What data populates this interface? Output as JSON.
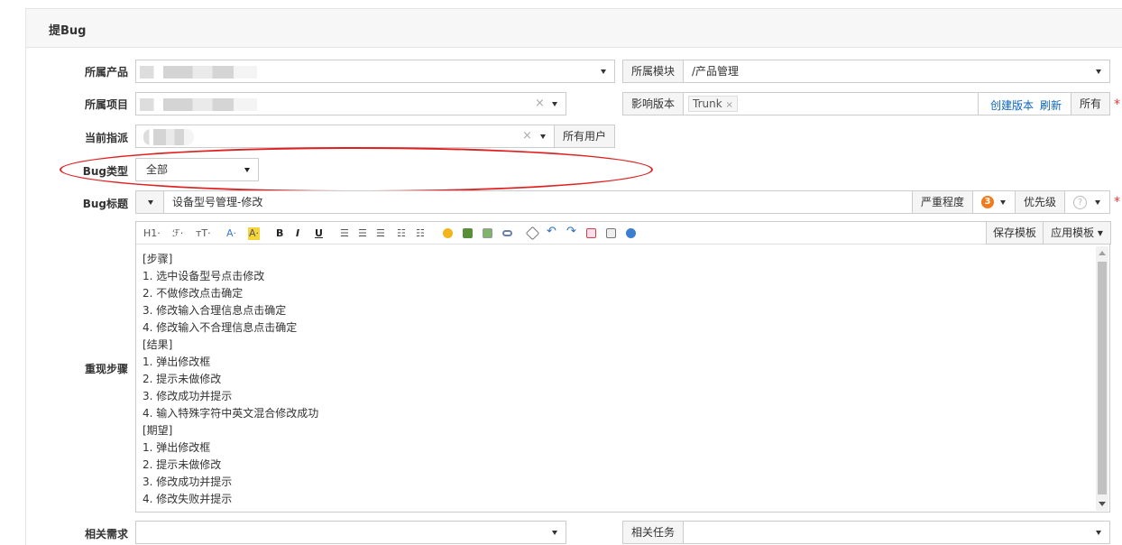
{
  "header": {
    "title": "提Bug"
  },
  "form": {
    "product": {
      "label": "所属产品"
    },
    "module": {
      "addon": "所属模块",
      "value": "/产品管理"
    },
    "project": {
      "label": "所属项目"
    },
    "build": {
      "addon": "影响版本",
      "tag": "Trunk",
      "create_link": "创建版本",
      "refresh_link": "刷新",
      "all_button": "所有"
    },
    "assign": {
      "label": "当前指派",
      "all_users": "所有用户"
    },
    "bug_type": {
      "label": "Bug类型",
      "value": "全部"
    },
    "bug_title": {
      "label": "Bug标题",
      "value": "设备型号管理-修改",
      "severity_addon": "严重程度",
      "severity_value": "3",
      "priority_addon": "优先级",
      "priority_value": "?"
    },
    "steps": {
      "label": "重现步骤",
      "toolbar": {
        "h1": "H1·",
        "font": "ℱ·",
        "size": "тT·",
        "bold": "B",
        "italic": "I",
        "underline": "U"
      },
      "save_template": "保存模板",
      "apply_template": "应用模板",
      "lines": [
        "[步骤]",
        "1. 选中设备型号点击修改",
        "2. 不做修改点击确定",
        "3. 修改输入合理信息点击确定",
        "4. 修改输入不合理信息点击确定",
        "[结果]",
        "1. 弹出修改框",
        "2. 提示未做修改",
        "3. 修改成功并提示",
        "4. 输入特殊字符中英文混合修改成功",
        "[期望]",
        "1. 弹出修改框",
        "2. 提示未做修改",
        "3. 修改成功并提示",
        "4. 修改失败并提示"
      ]
    },
    "story": {
      "label": "相关需求"
    },
    "task": {
      "addon": "相关任务"
    },
    "required_mark": "*",
    "clear_mark": "×"
  }
}
